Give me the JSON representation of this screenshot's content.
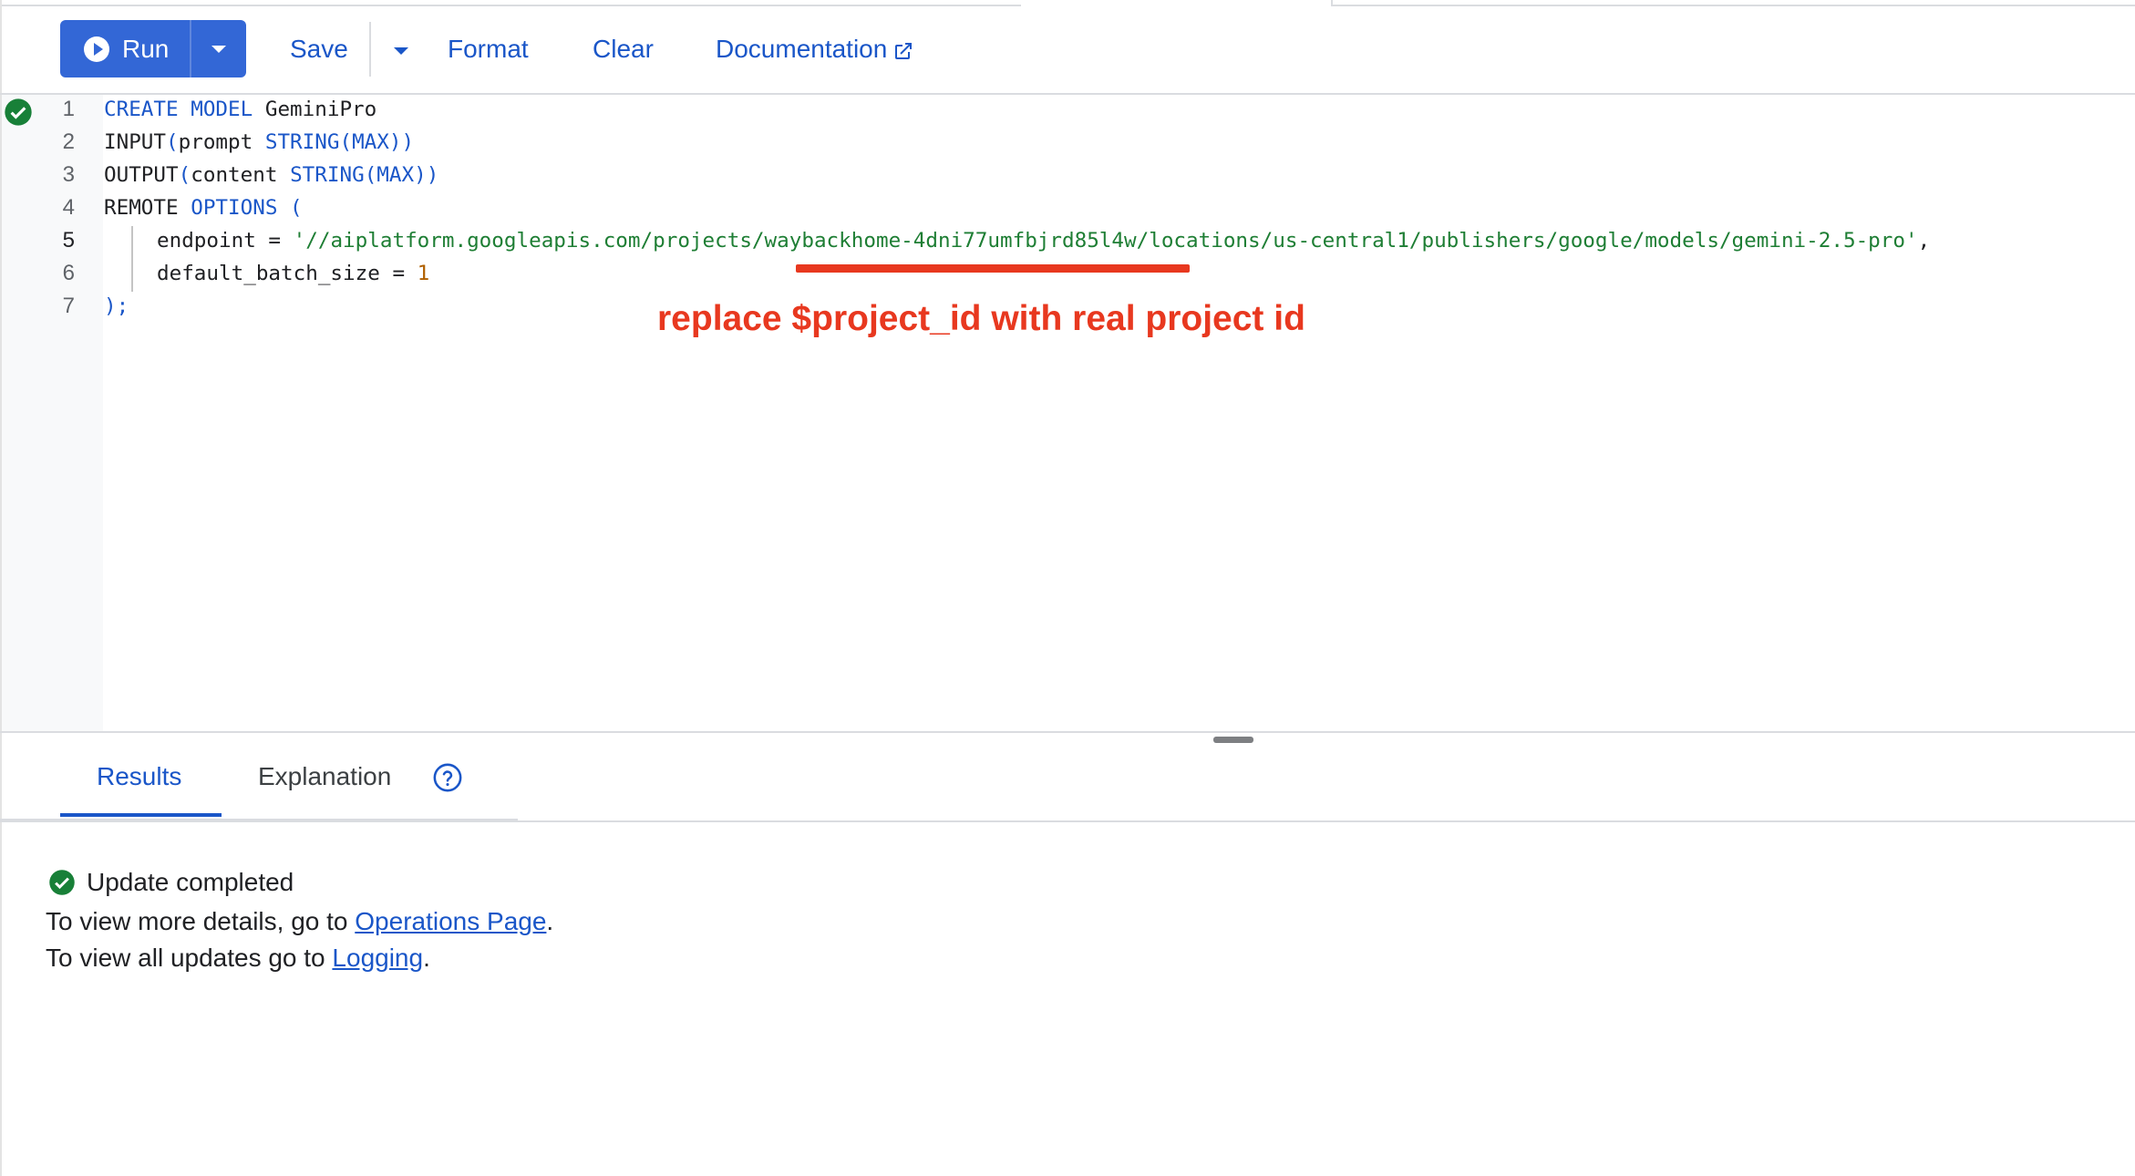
{
  "toolbar": {
    "run_label": "Run",
    "save_label": "Save",
    "format_label": "Format",
    "clear_label": "Clear",
    "documentation_label": "Documentation"
  },
  "editor": {
    "line_numbers": [
      "1",
      "2",
      "3",
      "4",
      "5",
      "6",
      "7"
    ],
    "active_line": "5",
    "lines": {
      "l1": {
        "kw1": "CREATE MODEL",
        "rest": " GeminiPro"
      },
      "l2": {
        "fn": "INPUT",
        "p1": "(",
        "arg": "prompt ",
        "type": "STRING",
        "p2": "(",
        "max": "MAX",
        "p3": "))"
      },
      "l3": {
        "fn": "OUTPUT",
        "p1": "(",
        "arg": "content ",
        "type": "STRING",
        "p2": "(",
        "max": "MAX",
        "p3": "))"
      },
      "l4": {
        "fn": "REMOTE ",
        "kw": "OPTIONS",
        "p1": " ("
      },
      "l5": {
        "key": "endpoint = ",
        "value": "'//aiplatform.googleapis.com/projects/waybackhome-4dni77umfbjrd85l4w/locations/us-central1/publishers/google/models/gemini-2.5-pro'",
        "tail": ","
      },
      "l6": {
        "key": "default_batch_size = ",
        "value": "1"
      },
      "l7": {
        "text": ");"
      }
    }
  },
  "annotation": {
    "text": "replace $project_id with real project id",
    "color": "#e8381f"
  },
  "results": {
    "tabs": [
      "Results",
      "Explanation"
    ],
    "active_tab": "Results",
    "status": "Update completed",
    "line1_prefix": "To view more details, go to ",
    "line1_link": "Operations Page",
    "line1_suffix": ".",
    "line2_prefix": "To view all updates go to ",
    "line2_link": "Logging",
    "line2_suffix": "."
  },
  "colors": {
    "accent": "#3367d6",
    "link": "#1a56c8",
    "success": "#188038",
    "annotation": "#e8381f"
  },
  "icons": {
    "run": "play-circle-icon",
    "run_menu": "chevron-down-icon",
    "save_menu": "chevron-down-icon",
    "documentation": "open-in-new-icon",
    "status": "check-circle-icon",
    "help": "help-icon"
  }
}
